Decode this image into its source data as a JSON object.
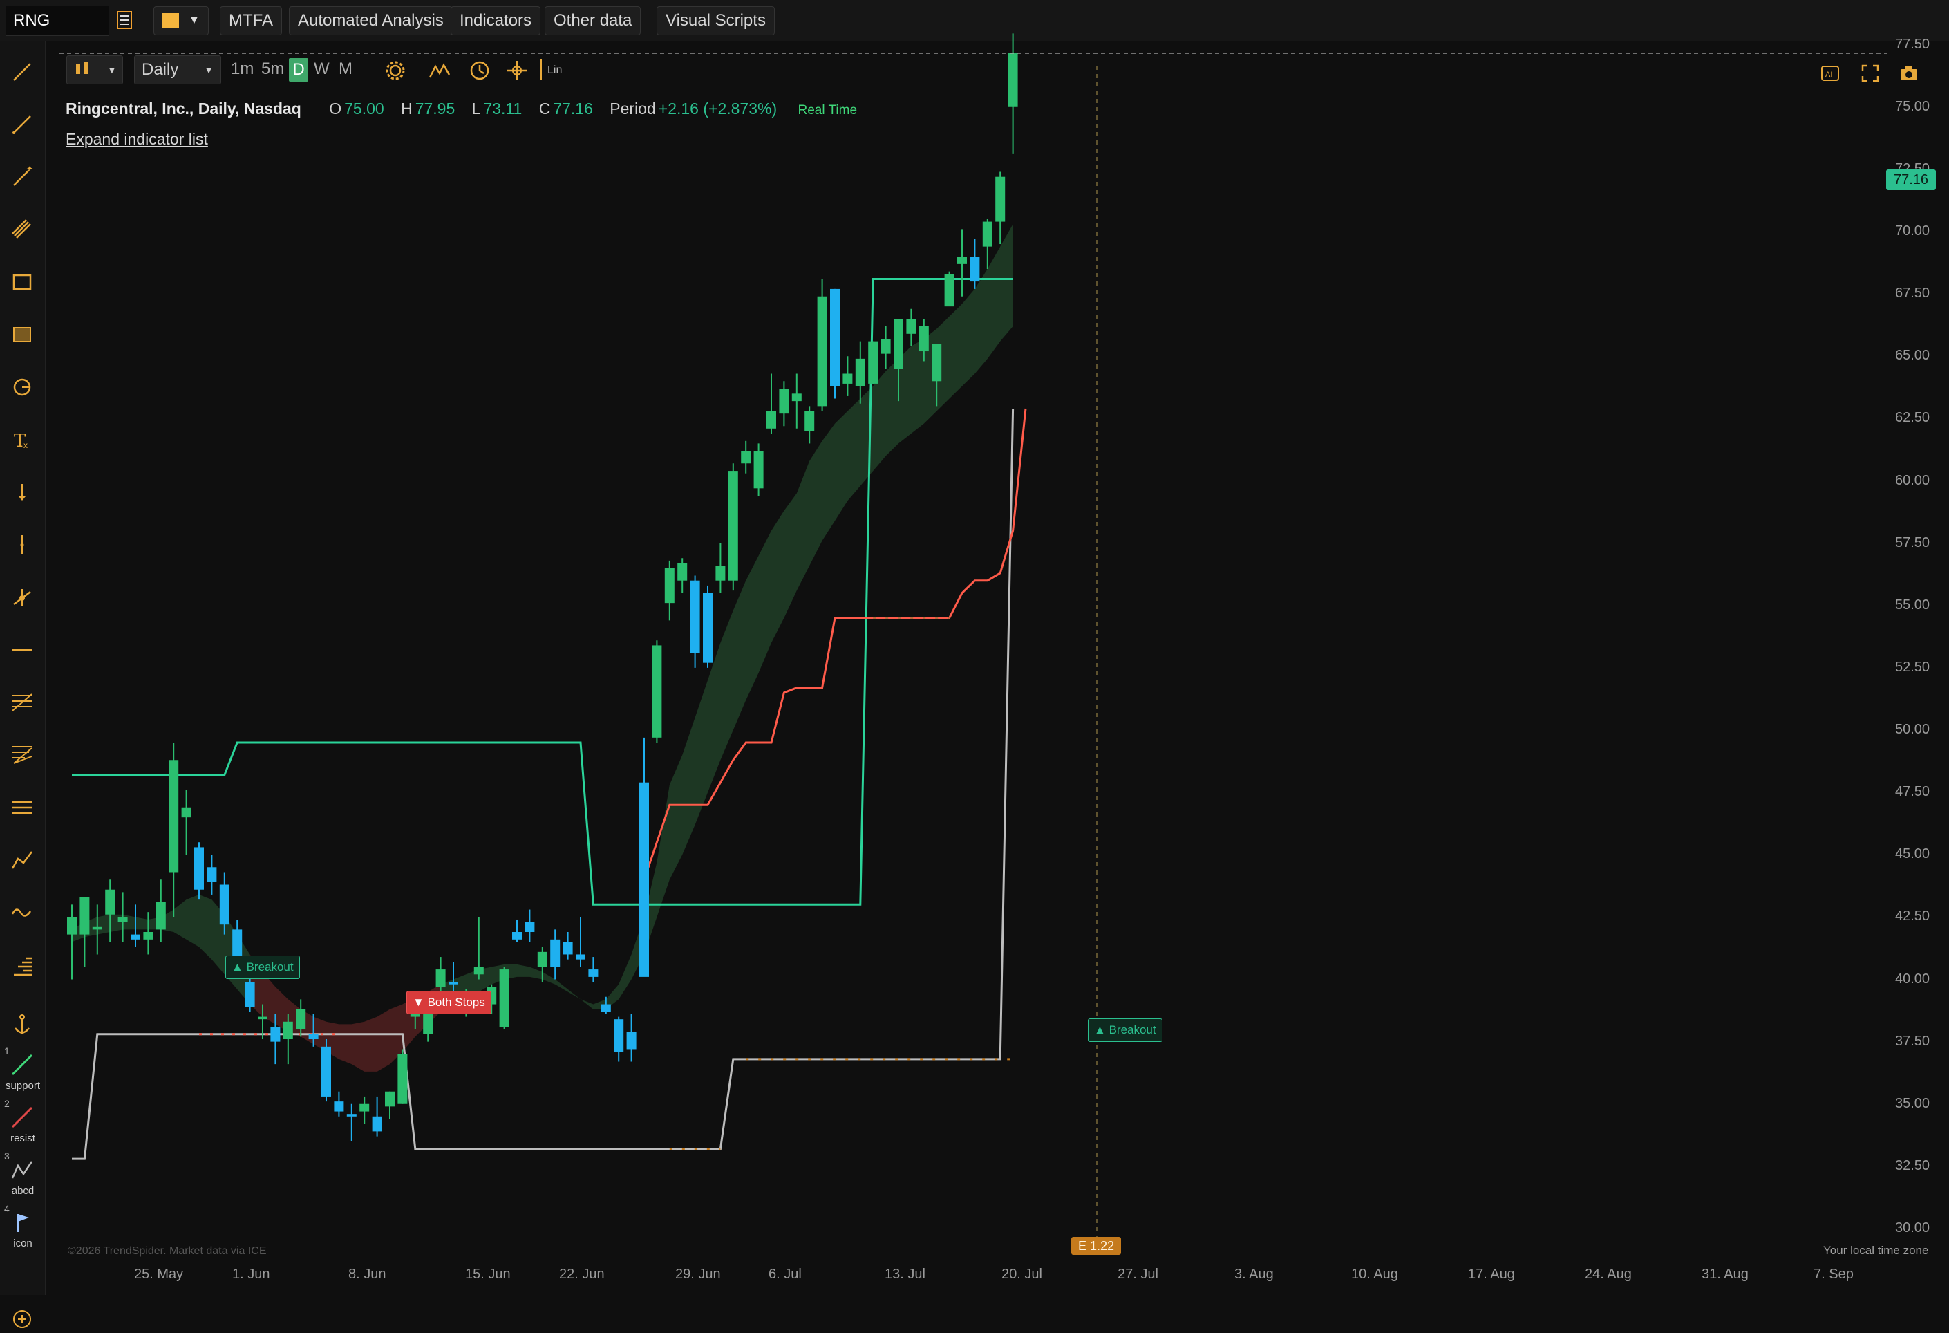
{
  "topbar": {
    "symbol": "RNG",
    "buttons": {
      "mtfa": "MTFA",
      "automated_analysis": "Automated Analysis",
      "indicators": "Indicators",
      "other_data": "Other data",
      "visual_scripts": "Visual Scripts"
    },
    "color_swatch": "#f5b53d"
  },
  "controls": {
    "timeframe": "Daily",
    "intervals": [
      "1m",
      "5m",
      "D",
      "W",
      "M"
    ],
    "active_interval": "D",
    "lin": "Lin"
  },
  "header": {
    "title": "Ringcentral, Inc., Daily, Nasdaq",
    "o_label": "O",
    "o_value": "75.00",
    "h_label": "H",
    "h_value": "77.95",
    "l_label": "L",
    "l_value": "73.11",
    "c_label": "C",
    "c_value": "77.16",
    "period_label": "Period",
    "period_value": "+2.16 (+2.873%)",
    "realtime": "Real Time"
  },
  "expand_link": "Expand indicator list",
  "presets": [
    {
      "num": "1",
      "label": "support"
    },
    {
      "num": "2",
      "label": "resist"
    },
    {
      "num": "3",
      "label": "abcd"
    },
    {
      "num": "4",
      "label": "icon"
    }
  ],
  "y_axis": [
    "77.50",
    "75.00",
    "72.50",
    "70.00",
    "67.50",
    "65.00",
    "62.50",
    "60.00",
    "57.50",
    "55.00",
    "52.50",
    "50.00",
    "47.50",
    "45.00",
    "42.50",
    "40.00",
    "37.50",
    "35.00",
    "32.50",
    "30.00"
  ],
  "x_axis": [
    "25. May",
    "1. Jun",
    "8. Jun",
    "15. Jun",
    "22. Jun",
    "29. Jun",
    "6. Jul",
    "13. Jul",
    "20. Jul",
    "27. Jul",
    "3. Aug",
    "10. Aug",
    "17. Aug",
    "24. Aug",
    "31. Aug",
    "7. Sep"
  ],
  "last_price_tag": "77.16",
  "signals": {
    "breakout_1": "Breakout",
    "both_stops": "Both Stops",
    "breakout_2": "Breakout"
  },
  "earnings_marker": "E 1.22",
  "copyright": "©2026 TrendSpider. Market data via ICE",
  "timezone_label": "Your local time zone",
  "colors": {
    "up": "#2bbf6f",
    "down": "#1fb0f0",
    "upper_line": "#2bd49a",
    "lower_line": "#bdbdbd",
    "stop_line": "#ff5b4a",
    "cloud_up": "#1f3a25",
    "cloud_down": "#4a1f1f"
  },
  "chart_data": {
    "type": "candlestick",
    "title": "Ringcentral, Inc., Daily, Nasdaq",
    "ylim": [
      30,
      78
    ],
    "grid": false,
    "candles": [
      {
        "o": 41.8,
        "h": 43.0,
        "l": 40.0,
        "c": 42.5
      },
      {
        "o": 41.8,
        "h": 43.2,
        "l": 40.5,
        "c": 43.3
      },
      {
        "o": 42.0,
        "h": 43.0,
        "l": 41.0,
        "c": 42.1
      },
      {
        "o": 42.6,
        "h": 44.0,
        "l": 41.5,
        "c": 43.6
      },
      {
        "o": 42.3,
        "h": 43.5,
        "l": 41.5,
        "c": 42.5
      },
      {
        "o": 41.8,
        "h": 43.0,
        "l": 41.3,
        "c": 41.6
      },
      {
        "o": 41.6,
        "h": 42.7,
        "l": 41.0,
        "c": 41.9
      },
      {
        "o": 42.0,
        "h": 44.0,
        "l": 41.5,
        "c": 43.1
      },
      {
        "o": 44.3,
        "h": 49.5,
        "l": 42.5,
        "c": 48.8
      },
      {
        "o": 46.5,
        "h": 47.6,
        "l": 45.0,
        "c": 46.9
      },
      {
        "o": 45.3,
        "h": 45.5,
        "l": 43.2,
        "c": 43.6
      },
      {
        "o": 44.5,
        "h": 45.0,
        "l": 43.4,
        "c": 43.9
      },
      {
        "o": 43.8,
        "h": 44.3,
        "l": 41.8,
        "c": 42.2
      },
      {
        "o": 42.0,
        "h": 42.4,
        "l": 40.3,
        "c": 40.6
      },
      {
        "o": 39.9,
        "h": 40.5,
        "l": 38.7,
        "c": 38.9
      },
      {
        "o": 38.4,
        "h": 39.0,
        "l": 37.6,
        "c": 38.5
      },
      {
        "o": 38.1,
        "h": 38.6,
        "l": 36.6,
        "c": 37.5
      },
      {
        "o": 37.6,
        "h": 38.6,
        "l": 36.6,
        "c": 38.3
      },
      {
        "o": 38.0,
        "h": 39.2,
        "l": 37.7,
        "c": 38.8
      },
      {
        "o": 37.8,
        "h": 38.6,
        "l": 37.3,
        "c": 37.6
      },
      {
        "o": 37.3,
        "h": 37.6,
        "l": 35.1,
        "c": 35.3
      },
      {
        "o": 35.1,
        "h": 35.5,
        "l": 34.5,
        "c": 34.7
      },
      {
        "o": 34.6,
        "h": 35.0,
        "l": 33.5,
        "c": 34.5
      },
      {
        "o": 34.7,
        "h": 35.3,
        "l": 34.2,
        "c": 35.0
      },
      {
        "o": 34.5,
        "h": 35.3,
        "l": 33.7,
        "c": 33.9
      },
      {
        "o": 34.9,
        "h": 35.5,
        "l": 34.4,
        "c": 35.5
      },
      {
        "o": 35.0,
        "h": 37.2,
        "l": 35.0,
        "c": 37.0
      },
      {
        "o": 38.5,
        "h": 39.5,
        "l": 38.0,
        "c": 38.9
      },
      {
        "o": 37.8,
        "h": 38.9,
        "l": 37.5,
        "c": 38.7
      },
      {
        "o": 39.7,
        "h": 40.9,
        "l": 39.5,
        "c": 40.4
      },
      {
        "o": 39.9,
        "h": 40.7,
        "l": 39.0,
        "c": 39.8
      },
      {
        "o": 38.8,
        "h": 39.6,
        "l": 38.5,
        "c": 39.1
      },
      {
        "o": 40.2,
        "h": 42.5,
        "l": 40.0,
        "c": 40.5
      },
      {
        "o": 39.0,
        "h": 39.8,
        "l": 38.6,
        "c": 39.7
      },
      {
        "o": 38.1,
        "h": 40.5,
        "l": 38.0,
        "c": 40.4
      },
      {
        "o": 41.9,
        "h": 42.4,
        "l": 41.5,
        "c": 41.6
      },
      {
        "o": 42.3,
        "h": 42.8,
        "l": 41.5,
        "c": 41.9
      },
      {
        "o": 40.5,
        "h": 41.3,
        "l": 39.9,
        "c": 41.1
      },
      {
        "o": 41.6,
        "h": 42.0,
        "l": 40.0,
        "c": 40.5
      },
      {
        "o": 41.5,
        "h": 41.9,
        "l": 40.8,
        "c": 41.0
      },
      {
        "o": 41.0,
        "h": 42.5,
        "l": 40.5,
        "c": 40.8
      },
      {
        "o": 40.4,
        "h": 40.9,
        "l": 39.9,
        "c": 40.1
      },
      {
        "o": 39.0,
        "h": 39.3,
        "l": 38.6,
        "c": 38.7
      },
      {
        "o": 38.4,
        "h": 38.5,
        "l": 36.7,
        "c": 37.1
      },
      {
        "o": 37.9,
        "h": 38.6,
        "l": 36.7,
        "c": 37.2
      },
      {
        "o": 47.9,
        "h": 49.7,
        "l": 40.2,
        "c": 40.1
      },
      {
        "o": 49.7,
        "h": 53.6,
        "l": 49.5,
        "c": 53.4
      },
      {
        "o": 55.1,
        "h": 56.8,
        "l": 54.4,
        "c": 56.5
      },
      {
        "o": 56.0,
        "h": 56.9,
        "l": 55.5,
        "c": 56.7
      },
      {
        "o": 56.0,
        "h": 56.2,
        "l": 52.5,
        "c": 53.1
      },
      {
        "o": 55.5,
        "h": 55.8,
        "l": 52.5,
        "c": 52.7
      },
      {
        "o": 56.0,
        "h": 57.5,
        "l": 55.5,
        "c": 56.6
      },
      {
        "o": 56.0,
        "h": 60.7,
        "l": 55.6,
        "c": 60.4
      },
      {
        "o": 60.7,
        "h": 61.6,
        "l": 60.3,
        "c": 61.2
      },
      {
        "o": 59.7,
        "h": 61.5,
        "l": 59.4,
        "c": 61.2
      },
      {
        "o": 62.1,
        "h": 64.3,
        "l": 61.9,
        "c": 62.8
      },
      {
        "o": 62.7,
        "h": 64.0,
        "l": 62.2,
        "c": 63.7
      },
      {
        "o": 63.2,
        "h": 64.3,
        "l": 62.1,
        "c": 63.5
      },
      {
        "o": 62.0,
        "h": 63.0,
        "l": 61.5,
        "c": 62.8
      },
      {
        "o": 63.0,
        "h": 68.1,
        "l": 62.8,
        "c": 67.4
      },
      {
        "o": 67.7,
        "h": 67.7,
        "l": 63.3,
        "c": 63.8
      },
      {
        "o": 63.9,
        "h": 65.0,
        "l": 63.4,
        "c": 64.3
      },
      {
        "o": 63.8,
        "h": 65.6,
        "l": 63.1,
        "c": 64.9
      },
      {
        "o": 63.9,
        "h": 65.6,
        "l": 63.9,
        "c": 65.6
      },
      {
        "o": 65.1,
        "h": 66.2,
        "l": 64.5,
        "c": 65.7
      },
      {
        "o": 64.5,
        "h": 66.5,
        "l": 63.2,
        "c": 66.5
      },
      {
        "o": 65.9,
        "h": 66.9,
        "l": 65.4,
        "c": 66.5
      },
      {
        "o": 65.2,
        "h": 66.5,
        "l": 64.8,
        "c": 66.2
      },
      {
        "o": 64.0,
        "h": 65.5,
        "l": 63.0,
        "c": 65.5
      },
      {
        "o": 67.0,
        "h": 68.4,
        "l": 67.5,
        "c": 68.3
      },
      {
        "o": 68.7,
        "h": 70.1,
        "l": 67.4,
        "c": 69.0
      },
      {
        "o": 69.0,
        "h": 69.7,
        "l": 67.7,
        "c": 68.0
      },
      {
        "o": 69.4,
        "h": 70.5,
        "l": 68.5,
        "c": 70.4
      },
      {
        "o": 70.4,
        "h": 72.4,
        "l": 69.5,
        "c": 72.2
      },
      {
        "o": 75.0,
        "h": 77.95,
        "l": 73.11,
        "c": 77.16
      }
    ],
    "upper_band_steps": [
      48.2,
      48.2,
      48.2,
      48.2,
      48.2,
      48.2,
      48.2,
      48.2,
      48.2,
      48.2,
      48.2,
      48.2,
      48.2,
      49.5,
      49.5,
      49.5,
      49.5,
      49.5,
      49.5,
      49.5,
      49.5,
      49.5,
      49.5,
      49.5,
      49.5,
      49.5,
      49.5,
      49.5,
      49.5,
      49.5,
      49.5,
      49.5,
      49.5,
      49.5,
      49.5,
      49.5,
      49.5,
      49.5,
      49.5,
      49.5,
      49.5,
      43.0,
      43.0,
      43.0,
      43.0,
      43.0,
      43.0,
      43.0,
      43.0,
      43.0,
      43.0,
      43.0,
      43.0,
      43.0,
      43.0,
      43.0,
      43.0,
      43.0,
      43.0,
      43.0,
      43.0,
      43.0,
      43.0,
      68.1,
      68.1,
      68.1,
      68.1,
      68.1,
      68.1,
      68.1,
      68.1,
      68.1,
      68.1,
      68.1,
      68.1
    ],
    "lower_band_steps": [
      32.8,
      32.8,
      37.8,
      37.8,
      37.8,
      37.8,
      37.8,
      37.8,
      37.8,
      37.8,
      37.8,
      37.8,
      37.8,
      37.8,
      37.8,
      37.8,
      37.8,
      37.8,
      37.8,
      37.8,
      37.8,
      37.8,
      37.8,
      37.8,
      37.8,
      37.8,
      37.8,
      33.2,
      33.2,
      33.2,
      33.2,
      33.2,
      33.2,
      33.2,
      33.2,
      33.2,
      33.2,
      33.2,
      33.2,
      33.2,
      33.2,
      33.2,
      33.2,
      33.2,
      33.2,
      33.2,
      33.2,
      33.2,
      33.2,
      33.2,
      33.2,
      33.2,
      36.8,
      36.8,
      36.8,
      36.8,
      36.8,
      36.8,
      36.8,
      36.8,
      36.8,
      36.8,
      36.8,
      36.8,
      36.8,
      36.8,
      36.8,
      36.8,
      36.8,
      36.8,
      36.8,
      36.8,
      36.8,
      36.8,
      62.9
    ],
    "stop_line": [
      {
        "i": 45,
        "v": 44.0
      },
      {
        "i": 47,
        "v": 47.0
      },
      {
        "i": 50,
        "v": 47.0
      },
      {
        "i": 52,
        "v": 48.8
      },
      {
        "i": 53,
        "v": 49.5
      },
      {
        "i": 55,
        "v": 49.5
      },
      {
        "i": 56,
        "v": 51.5
      },
      {
        "i": 57,
        "v": 51.7
      },
      {
        "i": 59,
        "v": 51.7
      },
      {
        "i": 60,
        "v": 54.5
      },
      {
        "i": 69,
        "v": 54.5
      },
      {
        "i": 70,
        "v": 55.5
      },
      {
        "i": 71,
        "v": 56.0
      },
      {
        "i": 72,
        "v": 56.0
      },
      {
        "i": 73,
        "v": 56.3
      },
      {
        "i": 74,
        "v": 58.0
      },
      {
        "i": 75,
        "v": 62.9
      }
    ],
    "cloud_upper": [
      42.0,
      42.3,
      42.5,
      42.6,
      42.6,
      42.5,
      42.4,
      42.5,
      42.8,
      43.2,
      43.4,
      43.2,
      42.6,
      41.8,
      41.0,
      40.3,
      39.7,
      39.2,
      38.8,
      38.5,
      38.3,
      38.2,
      38.2,
      38.3,
      38.5,
      38.8,
      39.0,
      39.3,
      39.5,
      39.8,
      40.0,
      40.2,
      40.4,
      40.5,
      40.6,
      40.6,
      40.5,
      40.3,
      40.0,
      39.6,
      39.2,
      39.0,
      39.2,
      39.8,
      41.0,
      42.5,
      44.7,
      47.8,
      49.0,
      50.5,
      52.0,
      53.5,
      54.8,
      56.0,
      57.0,
      58.0,
      58.8,
      59.5,
      60.8,
      61.6,
      62.3,
      62.8,
      63.3,
      63.8,
      64.4,
      64.9,
      65.4,
      65.7,
      66.1,
      66.6,
      67.1,
      67.7,
      68.5,
      69.4,
      70.3
    ],
    "cloud_lower": [
      41.5,
      41.7,
      41.8,
      41.9,
      42.0,
      42.0,
      42.0,
      42.0,
      41.9,
      41.6,
      41.3,
      40.8,
      40.2,
      39.6,
      39.0,
      38.5,
      38.2,
      37.9,
      37.7,
      37.4,
      37.1,
      36.8,
      36.6,
      36.3,
      36.3,
      36.6,
      37.1,
      37.7,
      38.2,
      38.7,
      39.0,
      39.2,
      39.5,
      39.8,
      40.0,
      40.1,
      40.1,
      40.0,
      39.8,
      39.5,
      39.2,
      38.8,
      38.8,
      39.2,
      40.0,
      41.0,
      42.5,
      44.0,
      45.0,
      46.2,
      47.5,
      48.8,
      50.0,
      51.2,
      52.3,
      53.5,
      54.5,
      55.6,
      56.6,
      57.6,
      58.4,
      59.2,
      59.8,
      60.4,
      61.0,
      61.5,
      61.9,
      62.3,
      62.8,
      63.3,
      63.8,
      64.3,
      64.9,
      65.6,
      66.2
    ]
  }
}
